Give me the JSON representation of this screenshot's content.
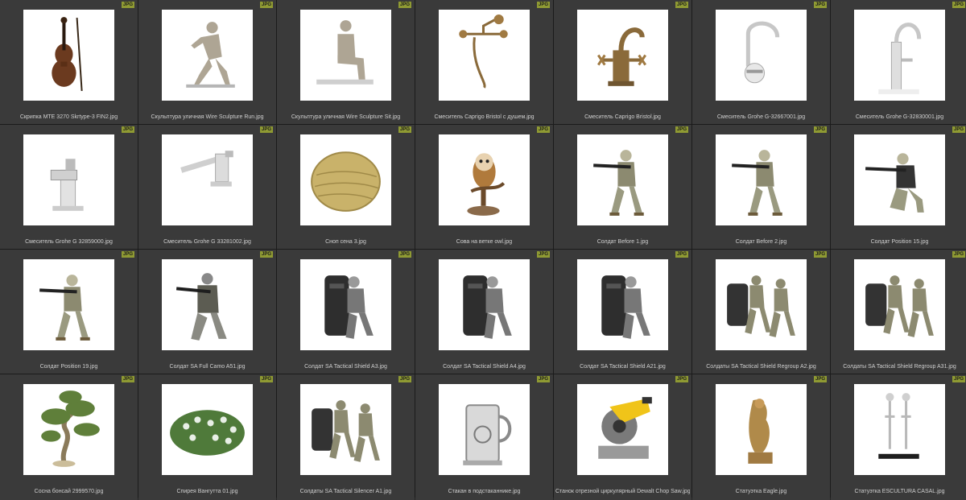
{
  "colors": {
    "background": "#3a3a3a",
    "separator": "#1b1b1b",
    "badge": "#8f9a33",
    "label_text": "#cfcfcf",
    "thumb_background": "#ffffff"
  },
  "items": [
    {
      "filename": "Скрипка MTE 3270 Skrtype-3 FIN2.jpg",
      "badge": "JPG",
      "icon": "violin-icon"
    },
    {
      "filename": "Скульптура уличная Wire Sculpture Run.jpg",
      "badge": "JPG",
      "icon": "wire-runner-sculpture-icon"
    },
    {
      "filename": "Скульптура уличная Wire Sculpture Sit.jpg",
      "badge": "JPG",
      "icon": "wire-sitting-sculpture-icon"
    },
    {
      "filename": "Смеситель Caprigo Bristol с душем.jpg",
      "badge": "JPG",
      "icon": "bath-mixer-shower-icon"
    },
    {
      "filename": "Смеситель Caprigo Bristol.jpg",
      "badge": "JPG",
      "icon": "bronze-mixer-icon"
    },
    {
      "filename": "Смеситель Grohe G-32667001.jpg",
      "badge": "JPG",
      "icon": "wall-faucet-icon"
    },
    {
      "filename": "Смеситель Grohe G-32830001.jpg",
      "badge": "JPG",
      "icon": "basin-faucet-icon"
    },
    {
      "filename": "Смеситель Grohe G 32859000.jpg",
      "badge": "JPG",
      "icon": "chrome-faucet-icon"
    },
    {
      "filename": "Смеситель Grohe G 33281002.jpg",
      "badge": "JPG",
      "icon": "kitchen-faucet-icon"
    },
    {
      "filename": "Сноп сена 3.jpg",
      "badge": "JPG",
      "icon": "hay-bale-icon"
    },
    {
      "filename": "Сова на ветке owl.jpg",
      "badge": "JPG",
      "icon": "owl-icon"
    },
    {
      "filename": "Солдат Before 1.jpg",
      "badge": "JPG",
      "icon": "soldier-aiming-icon"
    },
    {
      "filename": "Солдат Before 2.jpg",
      "badge": "JPG",
      "icon": "soldier-aiming-icon"
    },
    {
      "filename": "Солдат Position 15.jpg",
      "badge": "JPG",
      "icon": "soldier-kneeling-icon"
    },
    {
      "filename": "Солдат Position 19.jpg",
      "badge": "JPG",
      "icon": "soldier-aiming-icon"
    },
    {
      "filename": "Солдат SA Full Camo A51.jpg",
      "badge": "JPG",
      "icon": "soldier-camo-icon"
    },
    {
      "filename": "Солдат SA Tactical Shield A3.jpg",
      "badge": "JPG",
      "icon": "soldier-shield-icon"
    },
    {
      "filename": "Солдат SA Tactical Shield A4.jpg",
      "badge": "JPG",
      "icon": "soldier-shield-icon"
    },
    {
      "filename": "Солдат SA Tactical Shield A21.jpg",
      "badge": "JPG",
      "icon": "soldier-shield-icon"
    },
    {
      "filename": "Солдаты SA Tactical Shield Regroup A2.jpg",
      "badge": "JPG",
      "icon": "soldiers-group-icon"
    },
    {
      "filename": "Солдаты SA Tactical Shield Regroup A31.jpg",
      "badge": "JPG",
      "icon": "soldiers-group-icon"
    },
    {
      "filename": "Сосна бонсай 2999570.jpg",
      "badge": "JPG",
      "icon": "bonsai-tree-icon"
    },
    {
      "filename": "Спирея Вангутта 01.jpg",
      "badge": "JPG",
      "icon": "shrub-icon"
    },
    {
      "filename": "Солдаты SA Tactical Silencer A1.jpg",
      "badge": "JPG",
      "icon": "soldiers-group-icon"
    },
    {
      "filename": "Стакан в подстаканнике.jpg",
      "badge": "JPG",
      "icon": "glass-holder-icon"
    },
    {
      "filename": "Станок отрезной циркулярный Dewalt Chop Saw.jpg",
      "badge": "JPG",
      "icon": "chop-saw-icon"
    },
    {
      "filename": "Статуэтка Eagle.jpg",
      "badge": "JPG",
      "icon": "eagle-statue-icon"
    },
    {
      "filename": "Статуэтка ESCULTURA CASAL.jpg",
      "badge": "JPG",
      "icon": "couple-sculpture-icon"
    }
  ]
}
